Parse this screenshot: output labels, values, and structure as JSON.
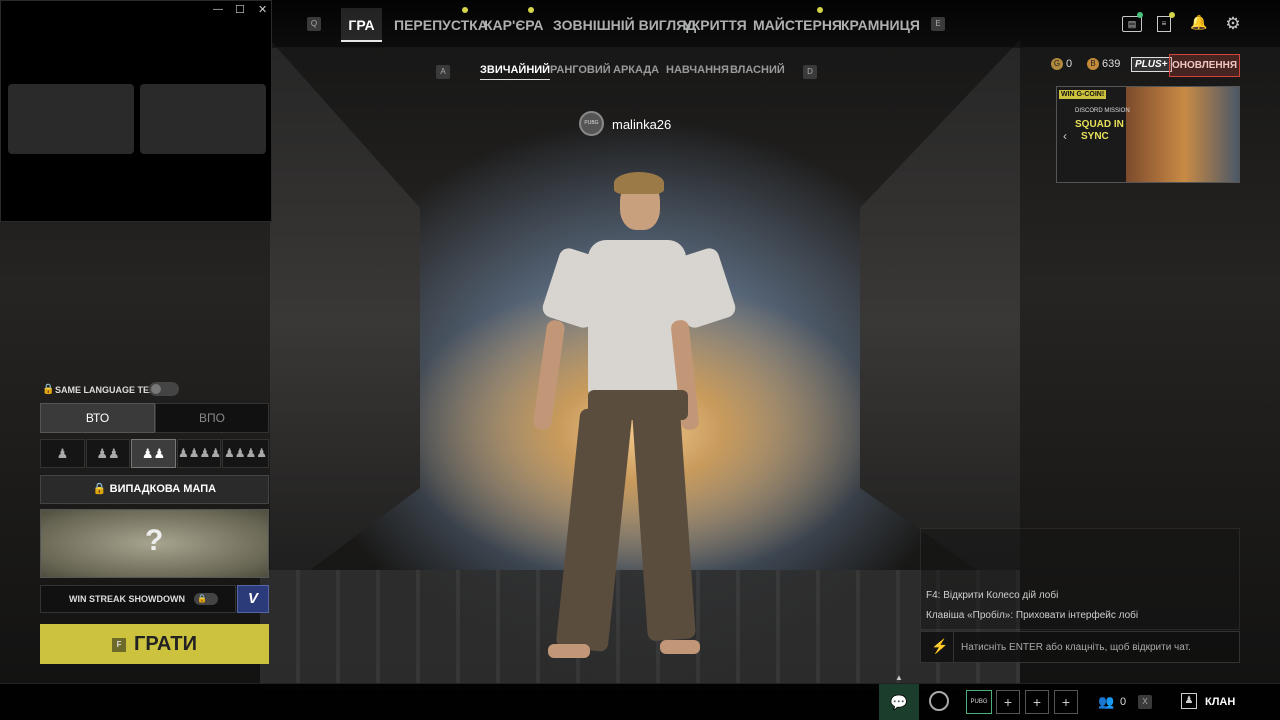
{
  "overlay_window": {
    "minimize": "—",
    "maximize": "☐",
    "close": "✕"
  },
  "nav": {
    "q_key": "Q",
    "e_key": "E",
    "items": [
      {
        "label": "ГРА",
        "active": true,
        "badge": false
      },
      {
        "label": "ПЕРЕПУСТКА",
        "active": false,
        "badge": true
      },
      {
        "label": "КАР'ЄРА",
        "active": false,
        "badge": true
      },
      {
        "label": "ЗОВНІШНІЙ ВИГЛЯД",
        "active": false,
        "badge": false
      },
      {
        "label": "УКРИТТЯ",
        "active": false,
        "badge": false
      },
      {
        "label": "МАЙСТЕРНЯ",
        "active": false,
        "badge": true
      },
      {
        "label": "КРАМНИЦЯ",
        "active": false,
        "badge": false
      }
    ]
  },
  "top_right_icons": [
    "store-icon",
    "news-icon",
    "bell-icon",
    "gear-icon"
  ],
  "subnav": {
    "a_key": "A",
    "d_key": "D",
    "items": [
      {
        "label": "ЗВИЧАЙНИЙ",
        "active": true
      },
      {
        "label": "РАНГОВИЙ",
        "active": false
      },
      {
        "label": "АРКАДА",
        "active": false
      },
      {
        "label": "НАВЧАННЯ",
        "active": false
      },
      {
        "label": "ВЛАСНИЙ",
        "active": false
      }
    ]
  },
  "currency": {
    "g_coin": "0",
    "bp": "639",
    "plus_badge": "PLUS+",
    "upgrade_button": "ОНОВЛЕННЯ"
  },
  "ad": {
    "tag": "WIN G-COIN!",
    "line1": "DISCORD MISSION",
    "line2": "SQUAD IN",
    "line3": "SYNC"
  },
  "player": {
    "name": "malinka26",
    "emblem": "PUBG"
  },
  "left_panel": {
    "same_language_label": "SAME LANGUAGE TEAM",
    "perspective": [
      "ВТО",
      "ВПО"
    ],
    "map_label": "ВИПАДКОВА МАПА",
    "map_placeholder": "?",
    "win_streak_label": "WIN STREAK SHOWDOWN",
    "v_badge": "V",
    "play_key": "F",
    "play_label": "ГРАТИ"
  },
  "chat": {
    "hint1": "F4: Відкрити Колесо дій лобі",
    "hint2": "Клавіша «Пробіл»: Приховати інтерфейс лобі",
    "input_placeholder": "Натисніть ENTER або клацніть, щоб відкрити чат."
  },
  "bottom_bar": {
    "pubg_badge": "PUBG",
    "plus1": "+",
    "plus2": "+",
    "plus3": "+",
    "friends_count": "0",
    "x_key": "X",
    "clan_label": "КЛАН"
  },
  "colors": {
    "accent": "#cdc23e",
    "upgrade": "#d0463c",
    "badge_dot": "#d4d54a"
  }
}
